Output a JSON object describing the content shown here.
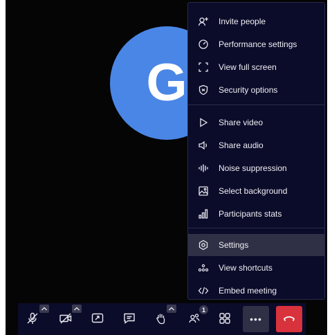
{
  "avatar": {
    "initial": "G",
    "color": "#4a86e6"
  },
  "menu": {
    "items": [
      {
        "label": "Invite people",
        "icon": "invite-people-icon"
      },
      {
        "label": "Performance settings",
        "icon": "gauge-icon"
      },
      {
        "label": "View full screen",
        "icon": "fullscreen-icon"
      },
      {
        "label": "Security options",
        "icon": "shield-icon"
      },
      {
        "label": "Share video",
        "icon": "play-icon"
      },
      {
        "label": "Share audio",
        "icon": "speaker-icon"
      },
      {
        "label": "Noise suppression",
        "icon": "waveform-icon"
      },
      {
        "label": "Select background",
        "icon": "image-icon"
      },
      {
        "label": "Participants stats",
        "icon": "signal-bars-icon"
      },
      {
        "label": "Settings",
        "icon": "gear-icon",
        "active": true
      },
      {
        "label": "View shortcuts",
        "icon": "shortcuts-icon"
      },
      {
        "label": "Embed meeting",
        "icon": "code-icon"
      }
    ]
  },
  "toolbar": {
    "participants_count": "1",
    "more_label": "•••",
    "hangup_color": "#d8323c"
  },
  "colors": {
    "menu_bg": "#0b0b2a",
    "menu_active": "#2f2f45",
    "stage_bg": "#050505"
  }
}
